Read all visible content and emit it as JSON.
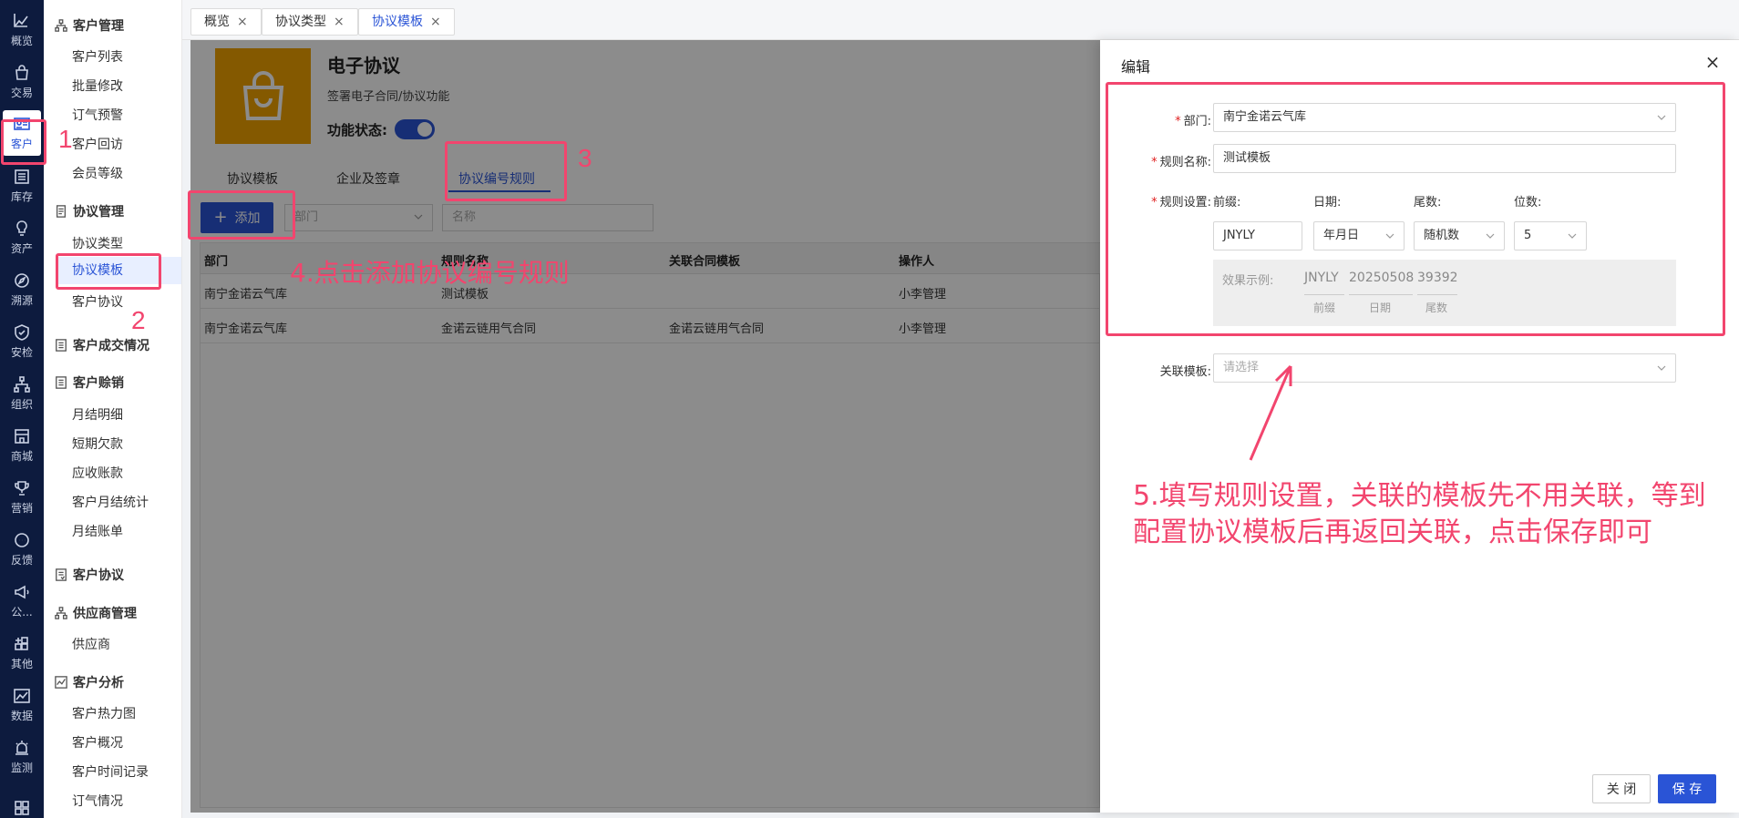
{
  "rail": [
    {
      "label": "概览",
      "icon": "chart-icon"
    },
    {
      "label": "交易",
      "icon": "bag-icon"
    },
    {
      "label": "客户",
      "icon": "id-card-icon",
      "active": true
    },
    {
      "label": "库存",
      "icon": "list-icon"
    },
    {
      "label": "资产",
      "icon": "bulb-icon"
    },
    {
      "label": "溯源",
      "icon": "compass-icon"
    },
    {
      "label": "安检",
      "icon": "shield-icon"
    },
    {
      "label": "组织",
      "icon": "org-icon"
    },
    {
      "label": "商城",
      "icon": "shop-icon"
    },
    {
      "label": "营销",
      "icon": "trophy-icon"
    },
    {
      "label": "反馈",
      "icon": "chat-icon"
    },
    {
      "label": "公...",
      "icon": "megaphone-icon"
    },
    {
      "label": "其他",
      "icon": "grid-plus-icon"
    },
    {
      "label": "数据",
      "icon": "line-chart-icon"
    },
    {
      "label": "监测",
      "icon": "alarm-icon"
    },
    {
      "label": "",
      "icon": "apps-icon"
    }
  ],
  "submenu": {
    "groups": {
      "customer_mgmt": "客户管理",
      "agreement_mgmt": "协议管理",
      "deal_status": "客户成交情况",
      "credit_sales": "客户赊销",
      "customer_agreement": "客户协议",
      "supplier_mgmt": "供应商管理",
      "customer_analysis": "客户分析"
    },
    "items": {
      "customer_list": "客户列表",
      "batch_edit": "批量修改",
      "gas_warning": "订气预警",
      "customer_visit": "客户回访",
      "member_level": "会员等级",
      "agreement_type": "协议类型",
      "agreement_template": "协议模板",
      "customer_agreement": "客户协议",
      "monthly_detail": "月结明细",
      "short_owed": "短期欠款",
      "receivables": "应收账款",
      "monthly_stats": "客户月结统计",
      "monthly_bill": "月结账单",
      "supplier": "供应商",
      "heatmap": "客户热力图",
      "overview": "客户概况",
      "time_record": "客户时间记录",
      "gas_status": "订气情况"
    }
  },
  "tabs": [
    {
      "label": "概览"
    },
    {
      "label": "协议类型"
    },
    {
      "label": "协议模板",
      "active": true
    }
  ],
  "product": {
    "title": "电子协议",
    "desc": "签署电子合同/协议功能",
    "status_label": "功能状态:",
    "status_on": true
  },
  "page_tabs": [
    "协议模板",
    "企业及签章",
    "协议编号规则"
  ],
  "toolbar": {
    "add_label": "添加",
    "dept_placeholder": "部门",
    "name_placeholder": "名称"
  },
  "table": {
    "headers": [
      "部门",
      "规则名称",
      "关联合同模板",
      "操作人"
    ],
    "rows": [
      [
        "南宁金诺云气库",
        "测试模板",
        "",
        "小李管理"
      ],
      [
        "南宁金诺云气库",
        "金诺云链用气合同",
        "金诺云链用气合同",
        "小李管理"
      ]
    ]
  },
  "drawer": {
    "title": "编辑",
    "dept_label": "部门:",
    "dept_value": "南宁金诺云气库",
    "rule_name_label": "规则名称:",
    "rule_name_value": "测试模板",
    "rule_setting_label": "规则设置:",
    "prefix_label": "前缀:",
    "prefix_value": "JNYLY",
    "date_label": "日期:",
    "date_value": "年月日",
    "tail_label": "尾数:",
    "tail_value": "随机数",
    "digits_label": "位数:",
    "digits_value": "5",
    "example_label": "效果示例:",
    "example_prefix": "JNYLY",
    "example_date": "20250508",
    "example_tail": "39392",
    "cap_prefix": "前缀",
    "cap_date": "日期",
    "cap_tail": "尾数",
    "template_label": "关联模板:",
    "template_placeholder": "请选择",
    "close_btn": "关 闭",
    "save_btn": "保 存"
  },
  "annotations": {
    "n1": "1",
    "n2": "2",
    "n3": "3",
    "step4": "4.点击添加协议编号规则",
    "step5_line1": "5.填写规则设置，关联的模板先不用关联，等到",
    "step5_line2": "配置协议模板后再返回关联，点击保存即可",
    "color": "#f2456e"
  },
  "colors": {
    "primary": "#2a54d6",
    "rail_bg": "#0d1b3e",
    "product_bg": "#f0a300"
  }
}
